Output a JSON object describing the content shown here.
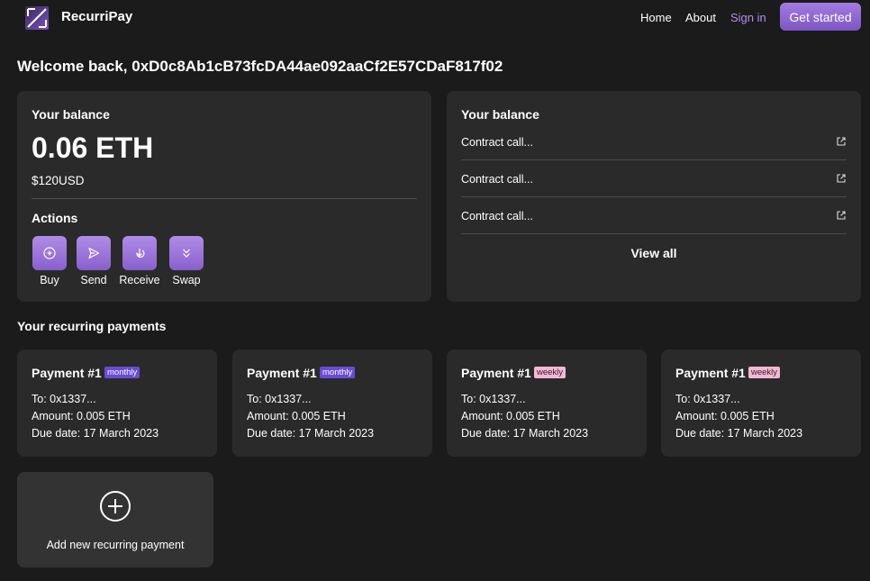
{
  "header": {
    "brand": "RecurriPay",
    "logo_icon": "recurripay-logo-icon",
    "nav": {
      "home": "Home",
      "about": "About",
      "sign_in": "Sign in",
      "get_started": "Get started"
    },
    "accent_color": "#9b74dd"
  },
  "welcome": "Welcome back, 0xD0c8Ab1cB73fcDA44ae092aaCf2E57CDaF817f02",
  "balance": {
    "title": "Your balance",
    "amount": "0.06 ETH",
    "usd": "$120USD",
    "actions_label": "Actions",
    "actions": [
      {
        "label": "Buy",
        "icon": "plus-circle-icon"
      },
      {
        "label": "Send",
        "icon": "send-icon"
      },
      {
        "label": "Receive",
        "icon": "receive-icon"
      },
      {
        "label": "Swap",
        "icon": "chevrons-down-icon"
      }
    ]
  },
  "activity": {
    "title": "Your balance",
    "rows": [
      {
        "text": "Contract call...",
        "icon": "external-link-icon"
      },
      {
        "text": "Contract call...",
        "icon": "external-link-icon"
      },
      {
        "text": "Contract call...",
        "icon": "external-link-icon"
      }
    ],
    "view_all": "View all"
  },
  "recurring": {
    "title": "Your recurring payments",
    "payments": [
      {
        "name": "Payment #1",
        "frequency": "monthly",
        "to": "To: 0x1337...",
        "amount": "Amount: 0.005 ETH",
        "due": "Due date: 17 March 2023"
      },
      {
        "name": "Payment #1",
        "frequency": "monthly",
        "to": "To: 0x1337...",
        "amount": "Amount: 0.005 ETH",
        "due": "Due date: 17 March 2023"
      },
      {
        "name": "Payment #1",
        "frequency": "weekly",
        "to": "To: 0x1337...",
        "amount": "Amount: 0.005 ETH",
        "due": "Due date: 17 March 2023"
      },
      {
        "name": "Payment #1",
        "frequency": "weekly",
        "to": "To: 0x1337...",
        "amount": "Amount: 0.005 ETH",
        "due": "Due date: 17 March 2023"
      }
    ],
    "add_label": "Add new recurring payment"
  }
}
